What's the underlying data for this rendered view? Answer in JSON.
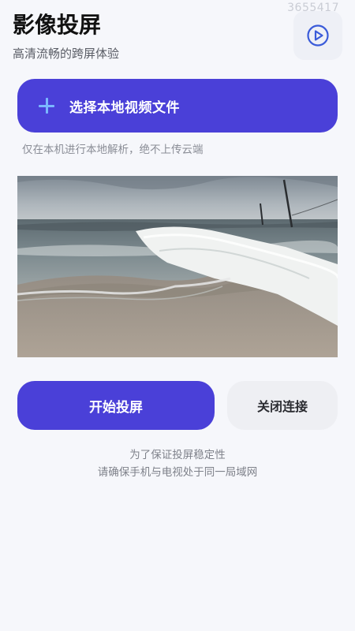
{
  "watermark": "3655417",
  "header": {
    "title": "影像投屏",
    "subtitle": "高清流畅的跨屏体验",
    "play_icon": "play-circle-icon"
  },
  "select": {
    "label": "选择本地视频文件",
    "icon": "plus-icon",
    "note": "仅在本机进行本地解析，绝不上传云端"
  },
  "actions": {
    "start_label": "开始投屏",
    "close_label": "关闭连接"
  },
  "tip": {
    "line1": "为了保证投屏稳定性",
    "line2": "请确保手机与电视处于同一局域网"
  },
  "colors": {
    "accent": "#4a40d8",
    "background": "#f6f7fb",
    "plus": "#7ab8ff"
  }
}
